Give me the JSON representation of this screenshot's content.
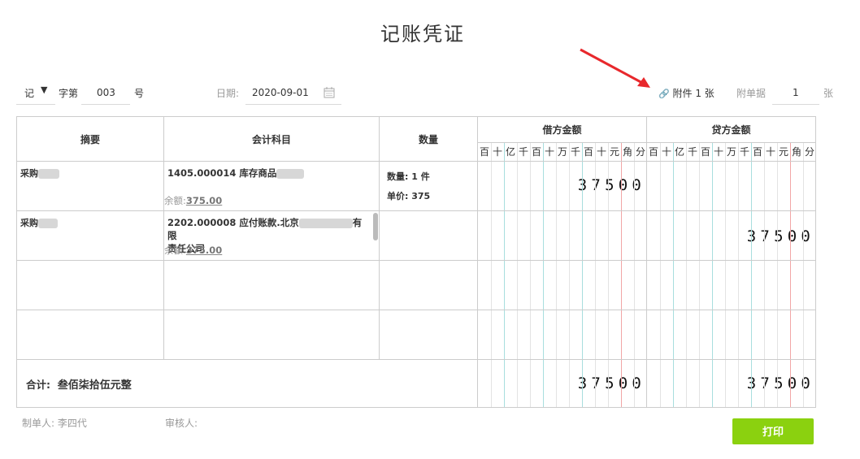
{
  "title": "记账凭证",
  "header": {
    "voucher_word": "记",
    "word_label": "字第",
    "voucher_no": "003",
    "no_label": "号",
    "date_label": "日期:",
    "date_value": "2020-09-01",
    "attachment_text": "附件 1 张",
    "doc_count_label": "附单据",
    "doc_count_value": "1",
    "doc_unit": "张"
  },
  "columns": {
    "summary": "摘要",
    "account": "会计科目",
    "quantity": "数量",
    "debit": "借方金额",
    "credit": "贷方金额",
    "digit_labels": [
      "百",
      "十",
      "亿",
      "千",
      "百",
      "十",
      "万",
      "千",
      "百",
      "十",
      "元",
      "角",
      "分"
    ]
  },
  "rows": [
    {
      "summary": "采购",
      "account": "1405.000014 库存商品",
      "balance_label": "余额:",
      "balance_value": "375.00",
      "qty_label": "数量: 1 件",
      "price_label": "单价: 375",
      "debit": "37500",
      "credit": ""
    },
    {
      "summary": "采购",
      "account_line1": "2202.000008 应付账款.北京",
      "account_suffix": "有限",
      "account_line2": "责任公司",
      "balance_label": "余额:",
      "balance_value": "375.00",
      "debit": "",
      "credit": "37500"
    }
  ],
  "total": {
    "label": "合计:",
    "words": "叁佰柒拾伍元整",
    "debit": "37500",
    "credit": "37500"
  },
  "footer": {
    "maker_label": "制单人:",
    "maker_name": "李四代",
    "reviewer_label": "审核人:",
    "print_button": "打印"
  },
  "colors": {
    "accent": "#8bd10f",
    "arrow": "#e8282c",
    "yuan_line": "#a8dede",
    "jiao_line": "#f1a6a6"
  }
}
